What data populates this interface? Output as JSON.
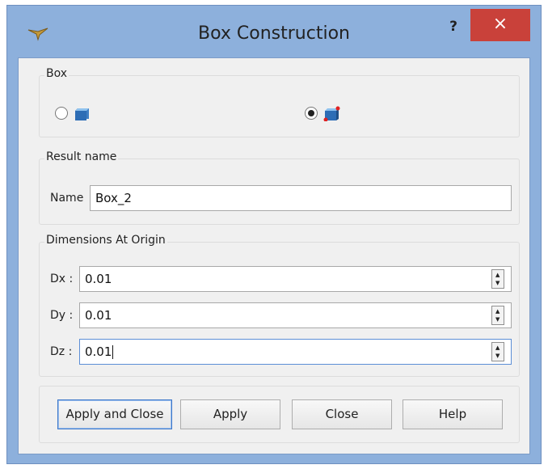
{
  "window": {
    "title": "Box Construction",
    "help_label": "?",
    "close_label": "×"
  },
  "box_group": {
    "label": "Box",
    "selected_option": 2
  },
  "result_group": {
    "label": "Result name",
    "name_label": "Name",
    "name_value": "Box_2"
  },
  "dims_group": {
    "label": "Dimensions At Origin",
    "fields": [
      {
        "label": "Dx :",
        "value": "0.01"
      },
      {
        "label": "Dy :",
        "value": "0.01"
      },
      {
        "label": "Dz :",
        "value": "0.01"
      }
    ]
  },
  "buttons": {
    "apply_close": "Apply and Close",
    "apply": "Apply",
    "close": "Close",
    "help": "Help"
  },
  "icons": {
    "app": "pin-icon",
    "box_option_1": "box-by-dimensions-icon",
    "box_option_2": "box-by-two-points-icon"
  },
  "colors": {
    "titlebar": "#8db0dc",
    "close_button": "#c9413a",
    "accent": "#5b8ed6"
  }
}
